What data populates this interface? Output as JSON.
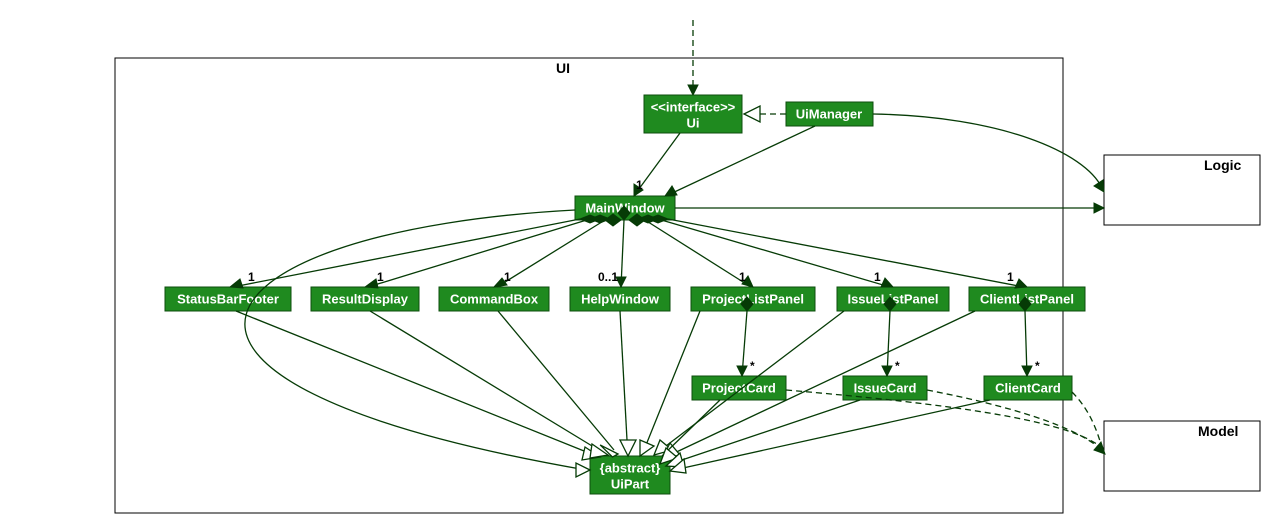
{
  "packages": {
    "ui": {
      "label": "UI"
    },
    "logic": {
      "label": "Logic"
    },
    "model": {
      "label": "Model"
    }
  },
  "classes": {
    "ui_interface": {
      "stereotype": "<<interface>>",
      "name": "Ui"
    },
    "ui_manager": {
      "name": "UiManager"
    },
    "main_window": {
      "name": "MainWindow"
    },
    "status_bar": {
      "name": "StatusBarFooter"
    },
    "result_display": {
      "name": "ResultDisplay"
    },
    "command_box": {
      "name": "CommandBox"
    },
    "help_window": {
      "name": "HelpWindow"
    },
    "project_list_panel": {
      "name": "ProjectListPanel"
    },
    "issue_list_panel": {
      "name": "IssueListPanel"
    },
    "client_list_panel": {
      "name": "ClientListPanel"
    },
    "project_card": {
      "name": "ProjectCard"
    },
    "issue_card": {
      "name": "IssueCard"
    },
    "client_card": {
      "name": "ClientCard"
    },
    "ui_part": {
      "stereotype": "{abstract}",
      "name": "UiPart"
    }
  },
  "multiplicities": {
    "mw_from_uimgr": "1",
    "status_bar": "1",
    "result_display": "1",
    "command_box": "1",
    "help_window": "0..1",
    "project_list_panel": "1",
    "issue_list_panel": "1",
    "client_list_panel": "1",
    "project_card": "*",
    "issue_card": "*",
    "client_card": "*"
  }
}
